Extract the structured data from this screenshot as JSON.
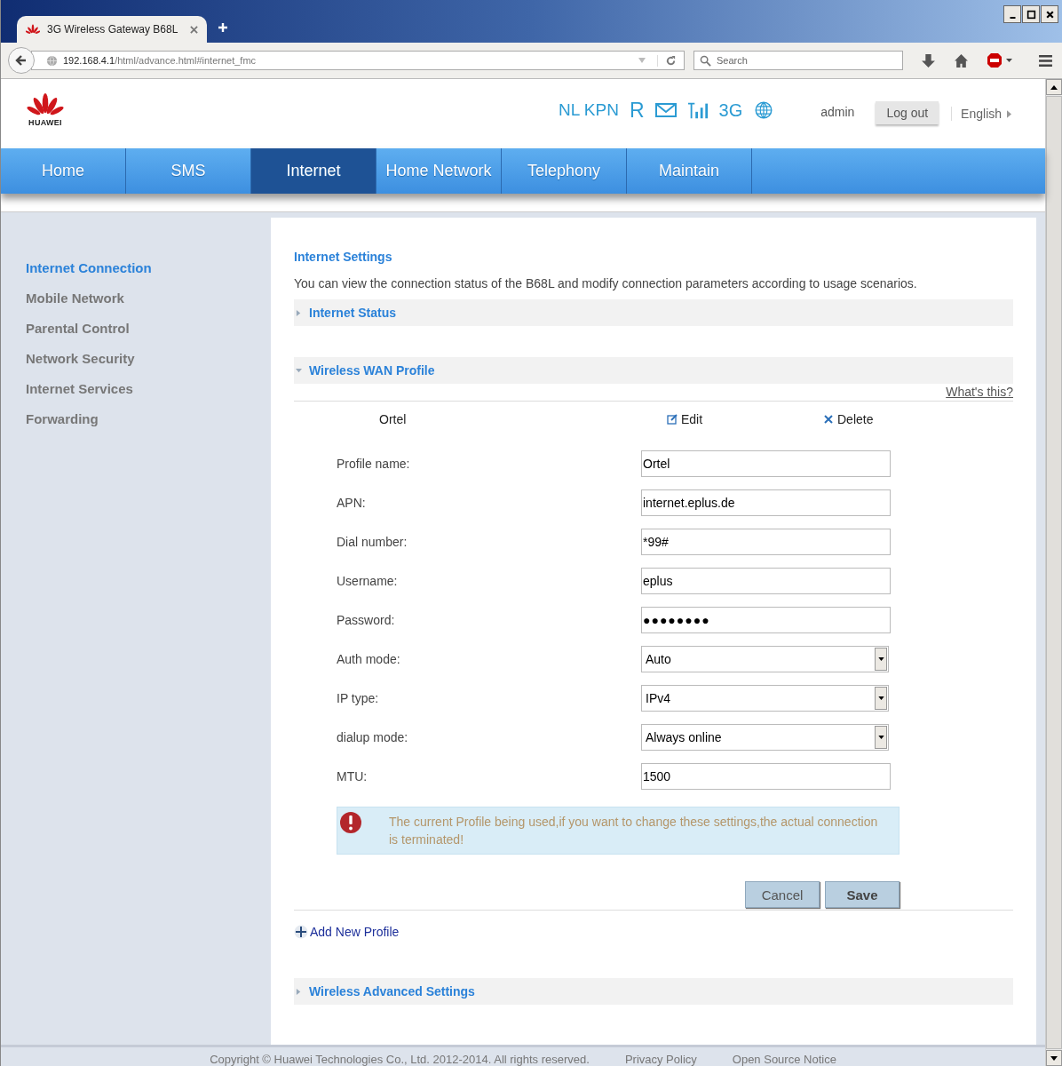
{
  "browser": {
    "tab_title": "3G Wireless Gateway B68L",
    "url_host": "192.168.4.1",
    "url_path": "/html/advance.html#internet_fmc",
    "search_placeholder": "Search"
  },
  "header": {
    "brand": "HUAWEI",
    "operator": "NL KPN",
    "roaming": "R",
    "network_type": "3G",
    "user": "admin",
    "logout": "Log out",
    "language": "English"
  },
  "nav": [
    {
      "label": "Home",
      "selected": false
    },
    {
      "label": "SMS",
      "selected": false
    },
    {
      "label": "Internet",
      "selected": true
    },
    {
      "label": "Home Network",
      "selected": false
    },
    {
      "label": "Telephony",
      "selected": false
    },
    {
      "label": "Maintain",
      "selected": false
    }
  ],
  "sidebar": {
    "items": [
      {
        "label": "Internet Connection",
        "selected": true
      },
      {
        "label": "Mobile Network",
        "selected": false
      },
      {
        "label": "Parental Control",
        "selected": false
      },
      {
        "label": "Network Security",
        "selected": false
      },
      {
        "label": "Internet Services",
        "selected": false
      },
      {
        "label": "Forwarding",
        "selected": false
      }
    ]
  },
  "main": {
    "title": "Internet Settings",
    "description": "You can view the connection status of the B68L and modify connection parameters according to usage scenarios.",
    "sections": [
      {
        "title": "Internet Status",
        "expanded": false
      },
      {
        "title": "Wireless WAN Profile",
        "expanded": true
      }
    ],
    "help_link": "What's this?",
    "profile": {
      "name": "Ortel",
      "edit": "Edit",
      "delete": "Delete"
    },
    "fields": [
      {
        "label": "Profile name:",
        "kind": "text",
        "value": "Ortel"
      },
      {
        "label": "APN:",
        "kind": "text",
        "value": "internet.eplus.de"
      },
      {
        "label": "Dial number:",
        "kind": "text",
        "value": "*99#"
      },
      {
        "label": "Username:",
        "kind": "text",
        "value": "eplus"
      },
      {
        "label": "Password:",
        "kind": "password",
        "value": "●●●●●●●●"
      },
      {
        "label": "Auth mode:",
        "kind": "select",
        "value": "Auto"
      },
      {
        "label": "IP type:",
        "kind": "select",
        "value": "IPv4"
      },
      {
        "label": "dialup mode:",
        "kind": "select",
        "value": "Always online"
      },
      {
        "label": "MTU:",
        "kind": "text",
        "value": "1500"
      }
    ],
    "warning": "The current Profile being used,if you want to change these settings,the actual connection is terminated!",
    "buttons": [
      "Cancel",
      "Save"
    ],
    "add_profile": "Add New Profile",
    "advanced": {
      "title": "Wireless Advanced Settings",
      "expanded": false
    }
  },
  "footer": {
    "copyright": "Copyright © Huawei Technologies Co., Ltd. 2012-2014. All rights reserved.",
    "links": [
      "Privacy Policy",
      "Open Source Notice"
    ]
  }
}
